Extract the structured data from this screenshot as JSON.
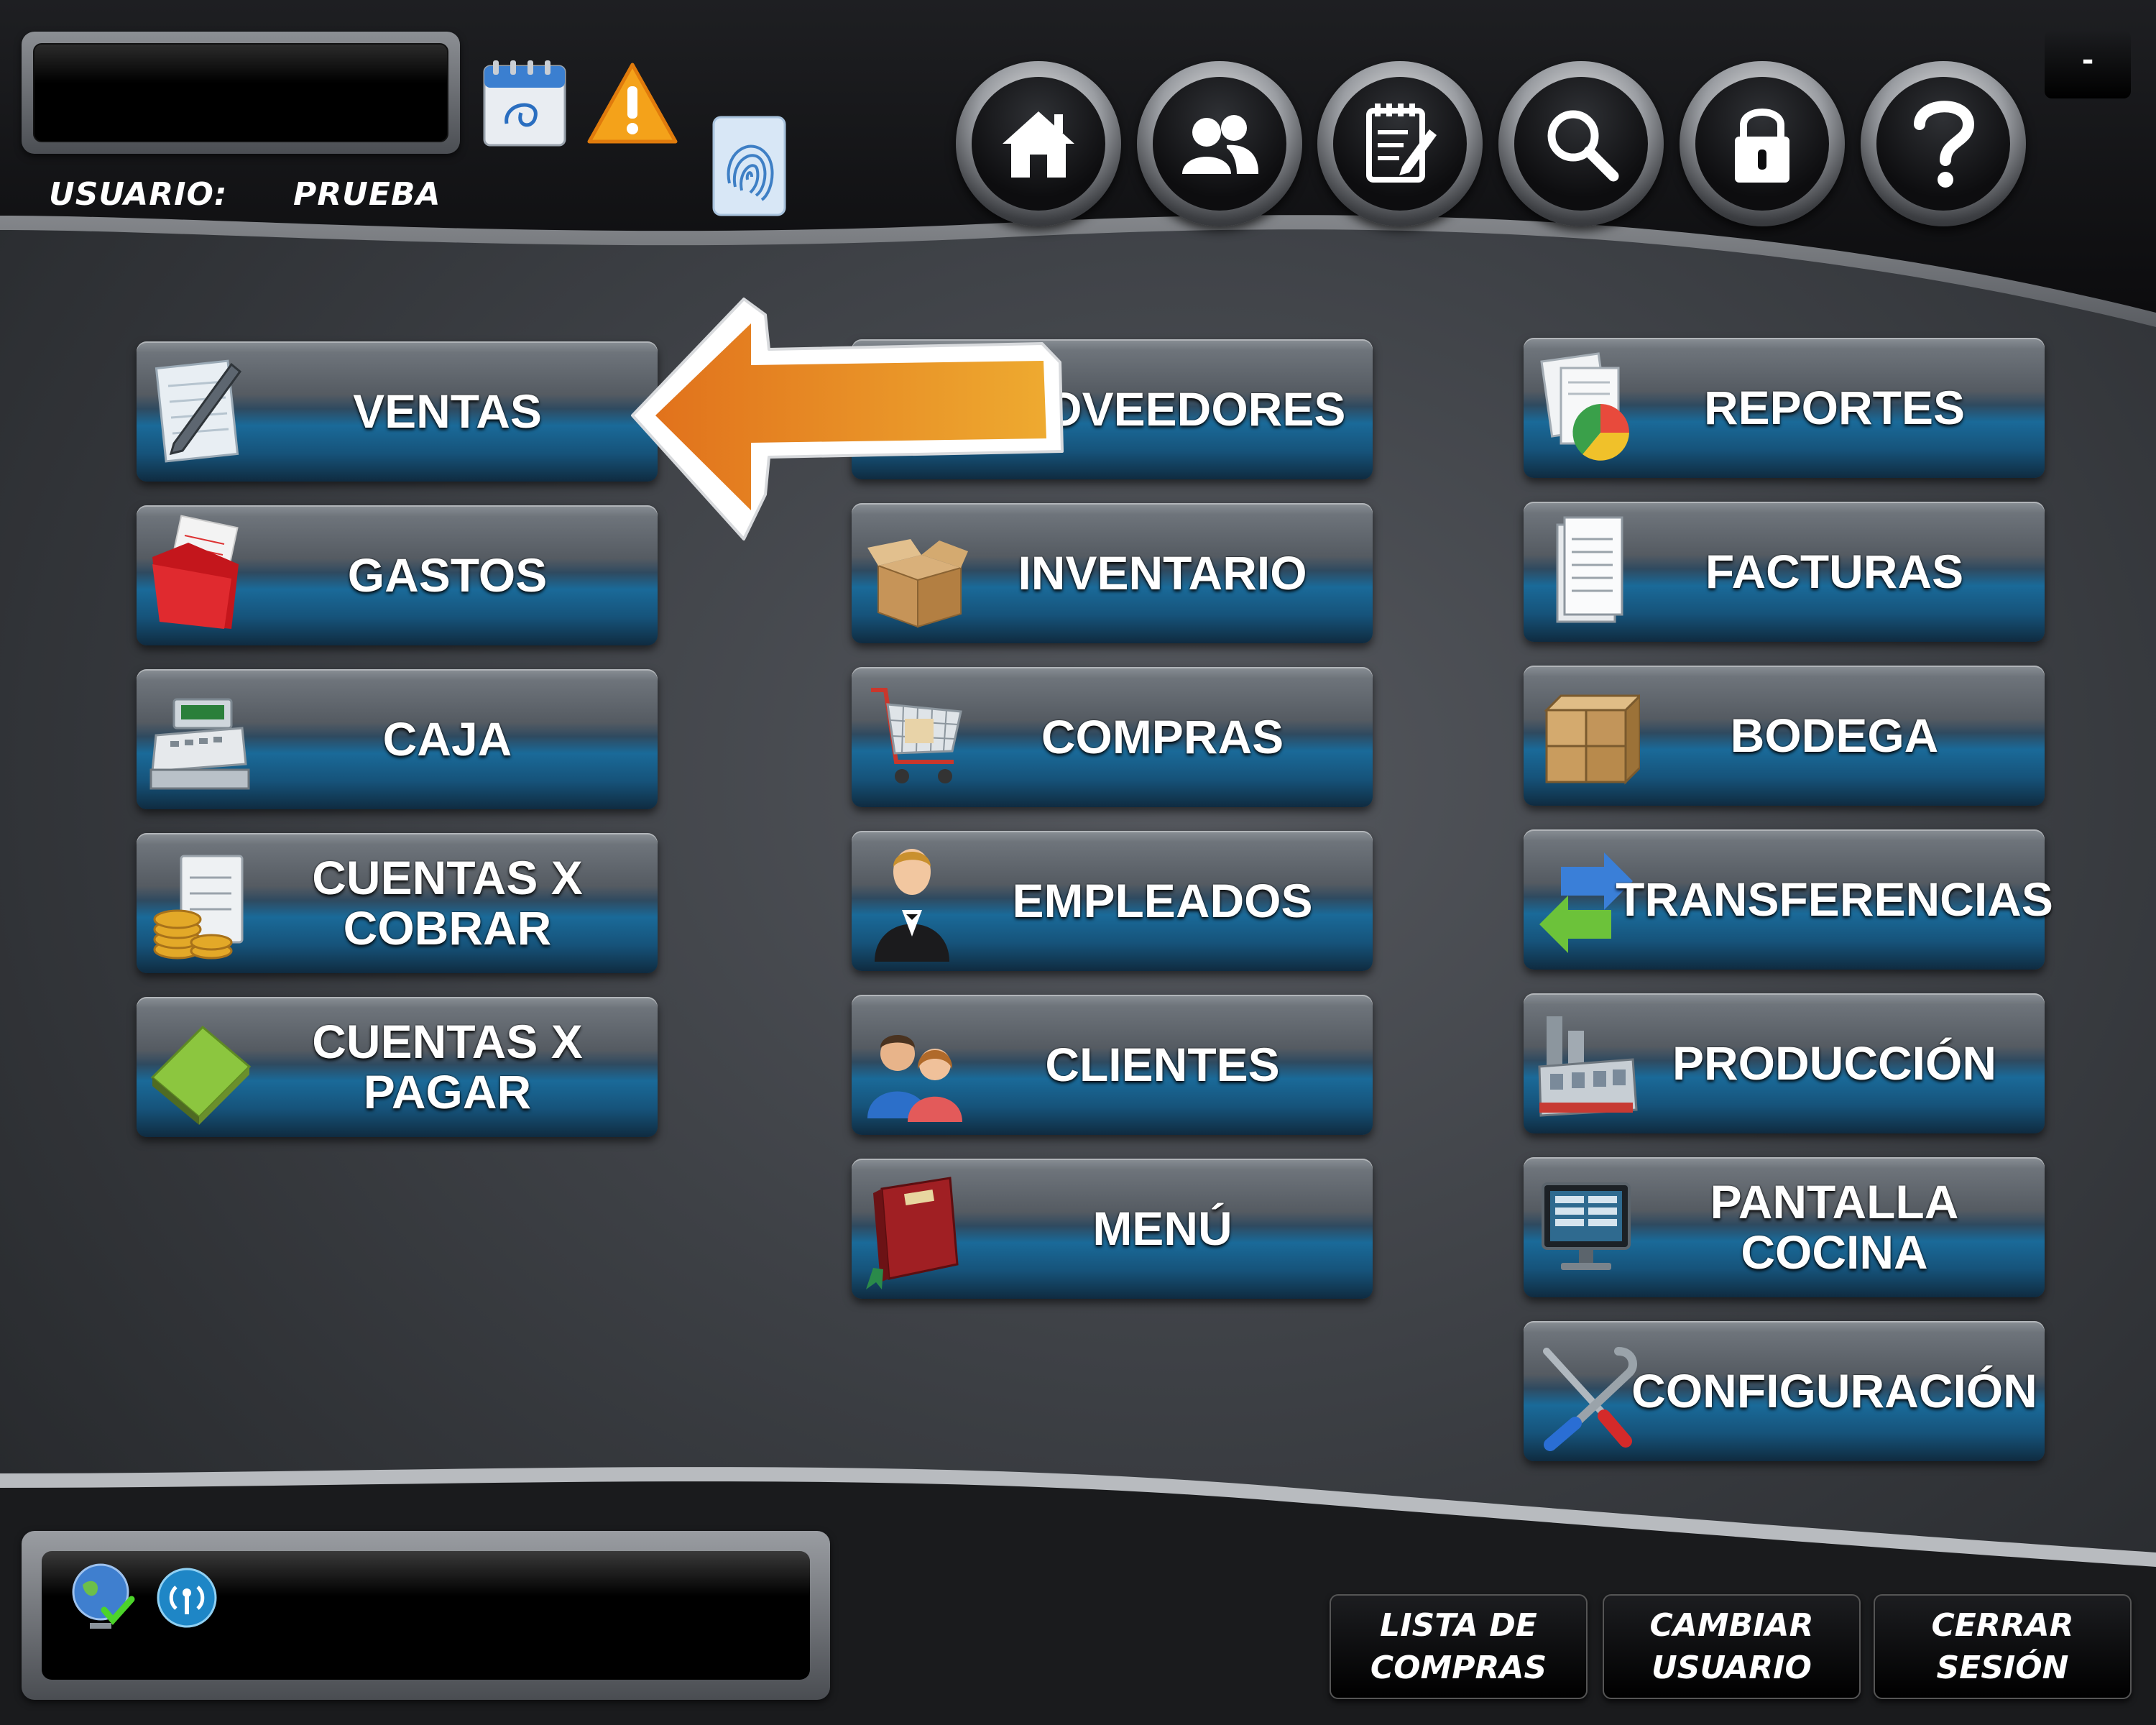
{
  "header": {
    "user_label": "USUARIO:",
    "user_name": "PRUEBA",
    "minimize_label": "-",
    "icons": [
      "calendar-icon",
      "warning-icon",
      "fingerprint-icon"
    ],
    "nav": [
      "home",
      "users",
      "notes",
      "search",
      "lock",
      "help"
    ]
  },
  "menu": {
    "col1": [
      "VENTAS",
      "GASTOS",
      "CAJA",
      "CUENTAS X\nCOBRAR",
      "CUENTAS X\nPAGAR"
    ],
    "col2": [
      "PROVEEDORES",
      "INVENTARIO",
      "COMPRAS",
      "EMPLEADOS",
      "CLIENTES",
      "MENÚ"
    ],
    "col3": [
      "REPORTES",
      "FACTURAS",
      "BODEGA",
      "TRANSFERENCIAS",
      "PRODUCCIÓN",
      "PANTALLA\nCOCINA",
      "CONFIGURACIÓN"
    ]
  },
  "footer": {
    "shopping_list": "LISTA DE\nCOMPRAS",
    "change_user": "CAMBIAR\nUSUARIO",
    "logout": "CERRAR\nSESIÓN"
  },
  "colors": {
    "arrow": "#e8821e",
    "button_blue": "#1a6a99",
    "background": "#3d4045"
  }
}
